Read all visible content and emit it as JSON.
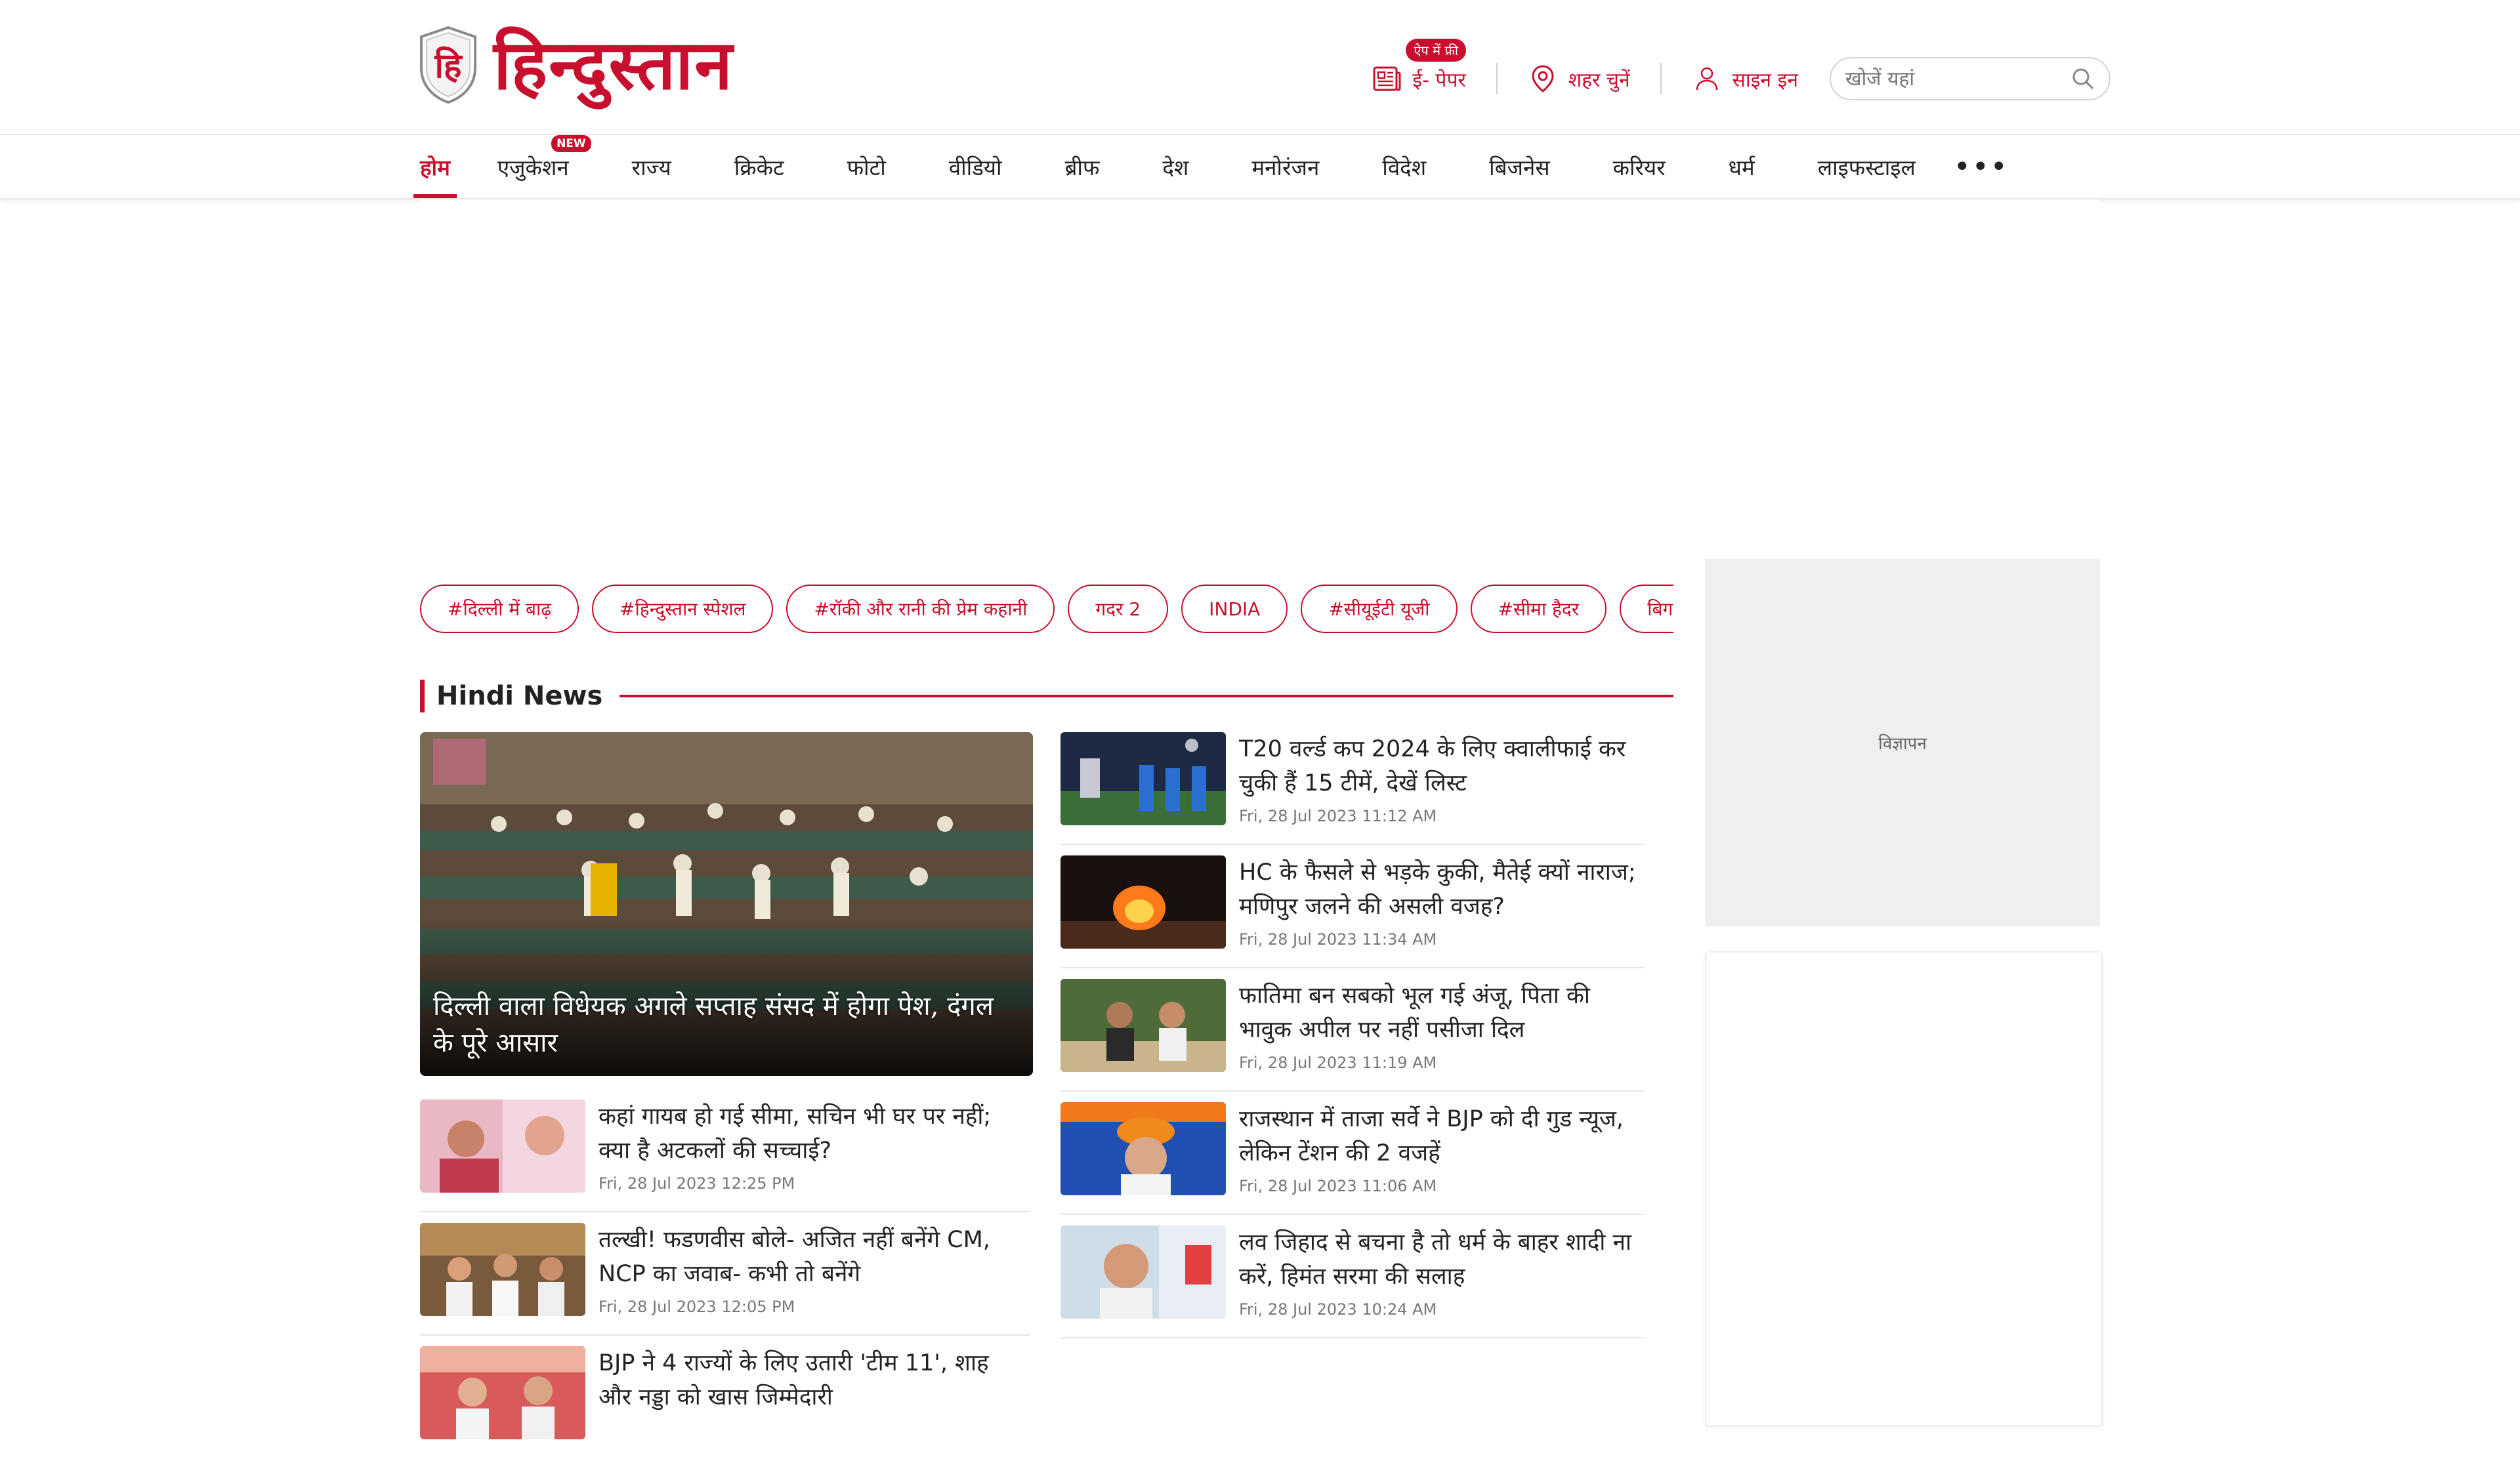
{
  "header": {
    "logo_text": "हिन्दुस्तान",
    "logo_mark": "हि",
    "epaper_badge": "ऐप में फ्री",
    "epaper_label": "ई- पेपर",
    "city_label": "शहर चुनें",
    "signin_label": "साइन इन",
    "search_placeholder": "खोजें यहां"
  },
  "nav": {
    "items": [
      "होम",
      "एजुकेशन",
      "राज्य",
      "क्रिकेट",
      "फोटो",
      "वीडियो",
      "ब्रीफ",
      "देश",
      "मनोरंजन",
      "विदेश",
      "बिजनेस",
      "करियर",
      "धर्म",
      "लाइफस्टाइल"
    ],
    "new_badge": "NEW",
    "more": "•••"
  },
  "tags": [
    "#दिल्ली में बाढ़",
    "#हिन्दुस्तान स्पेशल",
    "#रॉकी और रानी की प्रेम कहानी",
    "गदर 2",
    "INDIA",
    "#सीयूईटी यूजी",
    "#सीमा हैदर",
    "बिग"
  ],
  "section": {
    "title": "Hindi News"
  },
  "hero": {
    "title": "दिल्ली वाला विधेयक अगले सप्ताह संसद में होगा पेश, दंगल के पूरे आसार"
  },
  "left_news": [
    {
      "title": "कहां गायब हो गई सीमा, सचिन भी घर पर नहीं; क्या है अटकलों की सच्चाई?",
      "time": "Fri, 28 Jul 2023 12:25 PM"
    },
    {
      "title": "तल्खी! फडणवीस बोले- अजित नहीं बनेंगे CM, NCP का जवाब- कभी तो बनेंगे",
      "time": "Fri, 28 Jul 2023 12:05 PM"
    },
    {
      "title": "BJP ने 4 राज्यों के लिए उतारी 'टीम 11', शाह और नड्डा को खास जिम्मेदारी",
      "time": ""
    }
  ],
  "right_news": [
    {
      "title": "T20 वर्ल्ड कप 2024 के लिए क्वालीफाई कर चुकी हैं 15 टीमें, देखें लिस्ट",
      "time": "Fri, 28 Jul 2023 11:12 AM"
    },
    {
      "title": "HC के फैसले से भड़के कुकी, मैतेई क्यों नाराज; मणिपुर जलने की असली वजह?",
      "time": "Fri, 28 Jul 2023 11:34 AM"
    },
    {
      "title": "फातिमा बन सबको भूल गई अंजू, पिता की भावुक अपील पर नहीं पसीजा दिल",
      "time": "Fri, 28 Jul 2023 11:19 AM"
    },
    {
      "title": "राजस्थान में ताजा सर्वे ने BJP को दी गुड न्यूज, लेकिन टेंशन की 2 वजहें",
      "time": "Fri, 28 Jul 2023 11:06 AM"
    },
    {
      "title": "लव जिहाद से बचना है तो धर्म के बाहर शादी ना करें, हिमंत सरमा की सलाह",
      "time": "Fri, 28 Jul 2023 10:24 AM"
    }
  ],
  "sidebar": {
    "ad_label": "विज्ञापन"
  },
  "colors": {
    "brand": "#c8102e",
    "muted": "#777777",
    "border": "#e6e6e6"
  }
}
